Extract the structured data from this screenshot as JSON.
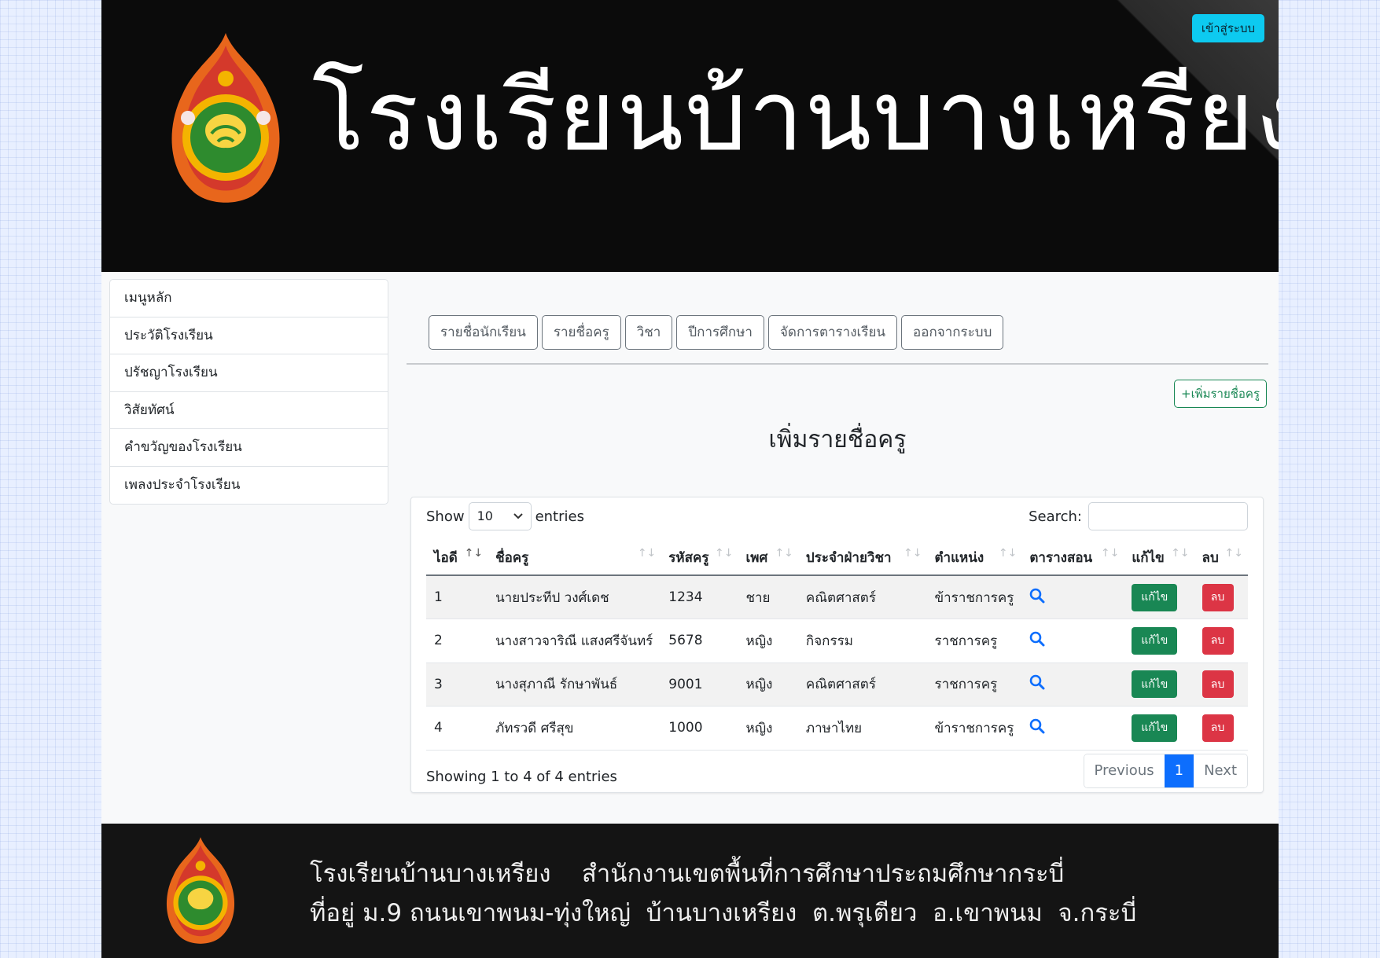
{
  "header": {
    "school_name": "โรงเรียนบ้านบางเหรียง",
    "login_label": "เข้าสู่ระบบ"
  },
  "sidebar": {
    "items": [
      {
        "label": "เมนูหลัก"
      },
      {
        "label": "ประวัติโรงเรียน"
      },
      {
        "label": "ปรัชญาโรงเรียน"
      },
      {
        "label": "วิสัยทัศน์"
      },
      {
        "label": "คำขวัญของโรงเรียน"
      },
      {
        "label": "เพลงประจำโรงเรียน"
      }
    ]
  },
  "tabs": [
    {
      "label": "รายชื่อนักเรียน"
    },
    {
      "label": "รายชื่อครู"
    },
    {
      "label": "วิชา"
    },
    {
      "label": "ปีการศึกษา"
    },
    {
      "label": "จัดการตารางเรียน"
    },
    {
      "label": "ออกจากระบบ"
    }
  ],
  "main": {
    "add_button": "+เพิ่มรายชื่อครู",
    "heading": "เพิ่มรายชื่อครู"
  },
  "table": {
    "show_label": "Show",
    "length_value": "10",
    "entries_label": "entries",
    "search_label": "Search:",
    "search_value": "",
    "columns": [
      "ไอดี",
      "ชื่อครู",
      "รหัสครู",
      "เพศ",
      "ประจำฝ่ายวิชา",
      "ตำแหน่ง",
      "ตารางสอน",
      "แก้ไข",
      "ลบ"
    ],
    "rows": [
      {
        "id": "1",
        "name": "นายประทีป วงศ์เดช",
        "code": "1234",
        "gender": "ชาย",
        "dept": "คณิตศาสตร์",
        "position": "ข้าราชการครู"
      },
      {
        "id": "2",
        "name": "นางสาวจาริณี แสงศรีจันทร์",
        "code": "5678",
        "gender": "หญิง",
        "dept": "กิจกรรม",
        "position": "ราชการครู"
      },
      {
        "id": "3",
        "name": "นางสุภาณี รักษาพันธ์",
        "code": "9001",
        "gender": "หญิง",
        "dept": "คณิตศาสตร์",
        "position": "ราชการครู"
      },
      {
        "id": "4",
        "name": "ภัทรวดี ศรีสุข",
        "code": "1000",
        "gender": "หญิง",
        "dept": "ภาษาไทย",
        "position": "ข้าราชการครู"
      }
    ],
    "edit_label": "แก้ไข",
    "delete_label": "ลบ",
    "info": "Showing 1 to 4 of 4 entries",
    "pager": {
      "previous": "Previous",
      "current": "1",
      "next": "Next"
    }
  },
  "footer": {
    "line1": "โรงเรียนบ้านบางเหรียง    สำนักงานเขตพื้นที่การศึกษาประถมศึกษากระบี่",
    "line2": "ที่อยู่ ม.9 ถนนเขาพนม-ทุ่งใหญ่  บ้านบางเหรียง  ต.พรุเตียว  อ.เขาพนม  จ.กระบี่"
  },
  "colors": {
    "accent": "#0d6efd",
    "edit": "#198754",
    "delete": "#dc3545",
    "login": "#0dcaf0"
  }
}
